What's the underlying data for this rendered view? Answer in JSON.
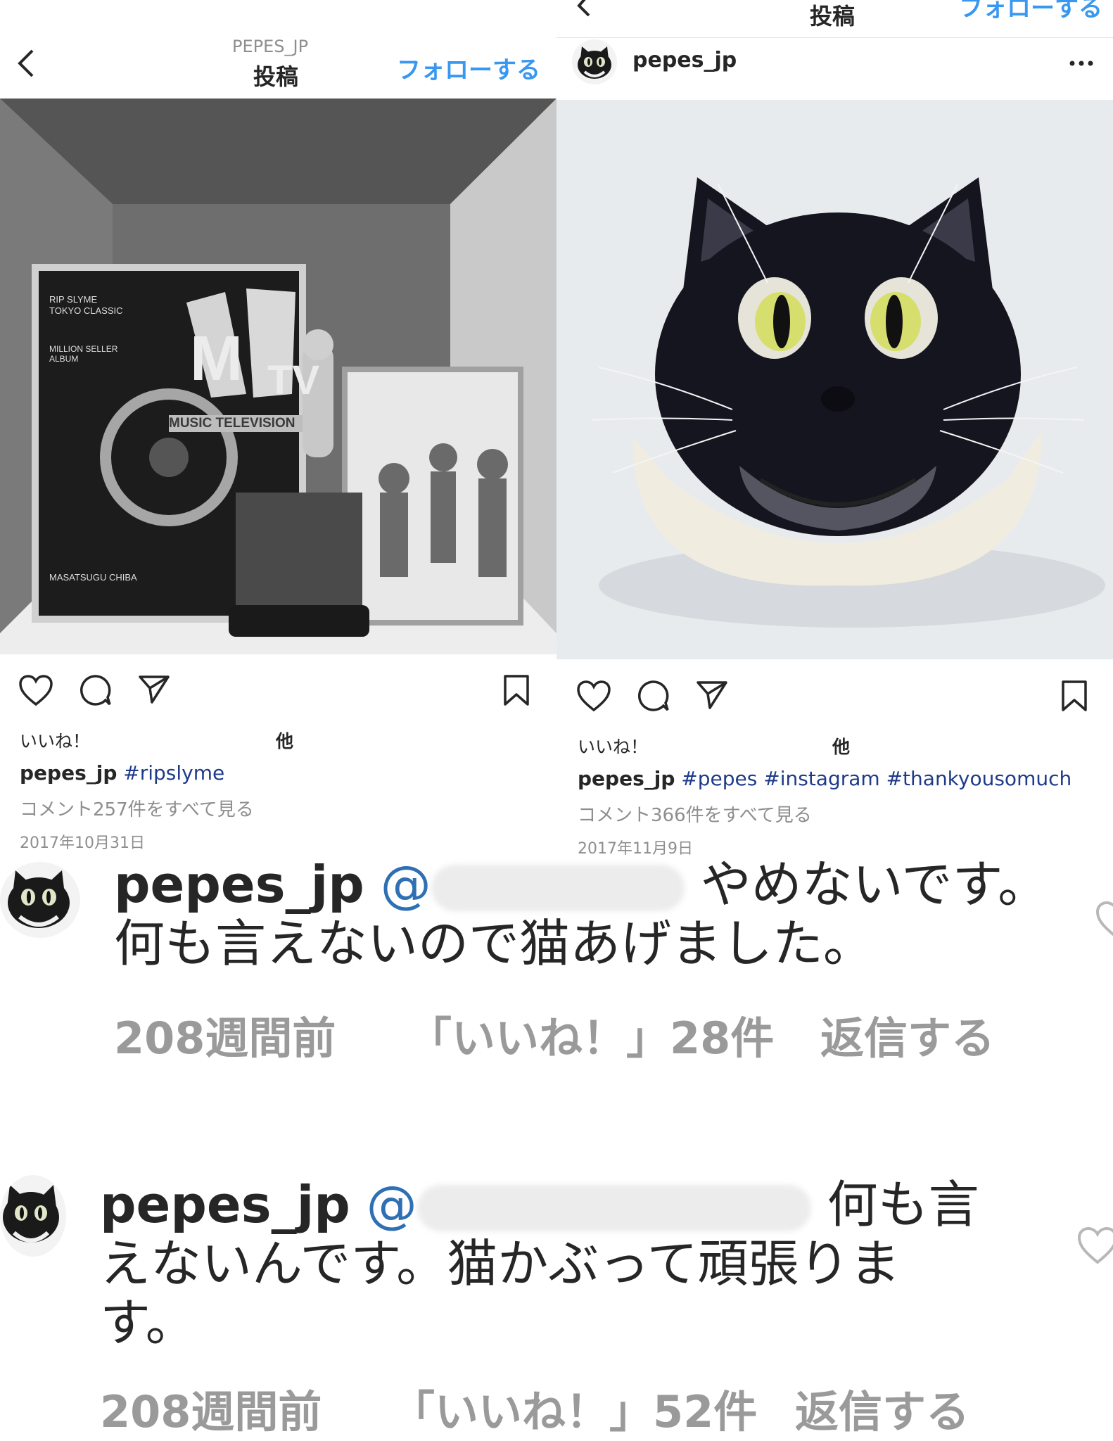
{
  "post1": {
    "account_upper": "PEPES_JP",
    "header_title": "投稿",
    "follow_label": "フォローする",
    "likes_label": "いいね！",
    "likes_other": "他",
    "caption_user": "pepes_jp",
    "caption_tags": [
      "#ripslyme"
    ],
    "comments_link": "コメント257件をすべて見る",
    "date": "2017年10月31日",
    "photo_texts": {
      "rip": "RIP SLYME",
      "tokyo": "TOKYO CLASSIC",
      "million": "MILLION SELLER",
      "album": "ALBUM",
      "masatsugu": "MASATSUGU CHIBA",
      "mtv_m": "M",
      "mtv_tv": "TV",
      "music_tv": "MUSIC TELEVISION"
    }
  },
  "post2": {
    "header_title": "投稿",
    "follow_label": "フォローする",
    "username": "pepes_jp",
    "likes_label": "いいね！",
    "likes_other": "他",
    "caption_user": "pepes_jp",
    "caption_tags": [
      "#pepes",
      "#instagram",
      "#thankyousomuch"
    ],
    "comments_link": "コメント366件をすべて見る",
    "date": "2017年11月9日"
  },
  "comments": [
    {
      "user": "pepes_jp",
      "mention": "@",
      "line1_tail": "やめないです。",
      "line2": "何も言えないので猫あげました。",
      "time": "208週間前",
      "likes": "「いいね！」28件",
      "reply": "返信する"
    },
    {
      "user": "pepes_jp",
      "mention": "@",
      "line1_tail": "何も言",
      "line2": "えないんです。猫かぶって頑張りま",
      "line3": "す。",
      "time": "208週間前",
      "likes": "「いいね！」52件",
      "reply": "返信する"
    }
  ],
  "icons": [
    "back-icon",
    "heart-icon",
    "comment-icon",
    "share-icon",
    "bookmark-icon",
    "more-icon"
  ]
}
